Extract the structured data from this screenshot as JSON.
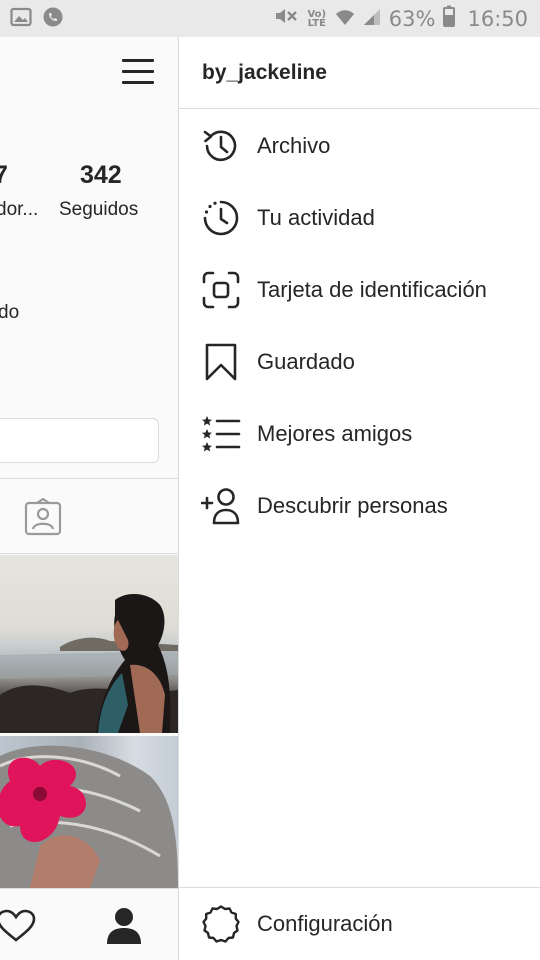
{
  "status_bar": {
    "network_small": "Vo) LTE",
    "battery_percent": "63%",
    "time": "16:50",
    "icons": [
      "image-icon",
      "whatsapp-icon",
      "mute-icon",
      "wifi-icon",
      "signal-icon",
      "battery-icon"
    ]
  },
  "profile": {
    "stats": [
      {
        "num": "7",
        "label": "dor..."
      },
      {
        "num": "342",
        "label": "Seguidos"
      }
    ],
    "bio_fragment": "do"
  },
  "drawer": {
    "username": "by_jackeline",
    "items": [
      {
        "label": "Archivo",
        "icon": "archive-history-icon"
      },
      {
        "label": "Tu actividad",
        "icon": "activity-clock-icon"
      },
      {
        "label": "Tarjeta de identificación",
        "icon": "nametag-scan-icon"
      },
      {
        "label": "Guardado",
        "icon": "bookmark-icon"
      },
      {
        "label": "Mejores amigos",
        "icon": "close-friends-list-icon"
      },
      {
        "label": "Descubrir personas",
        "icon": "add-person-icon"
      }
    ],
    "footer": {
      "label": "Configuración",
      "icon": "settings-gear-icon"
    }
  },
  "colors": {
    "text": "#262626",
    "divider": "#dbdbdb",
    "statusbar": "#e9e9e9",
    "flower": "#e0145a"
  }
}
